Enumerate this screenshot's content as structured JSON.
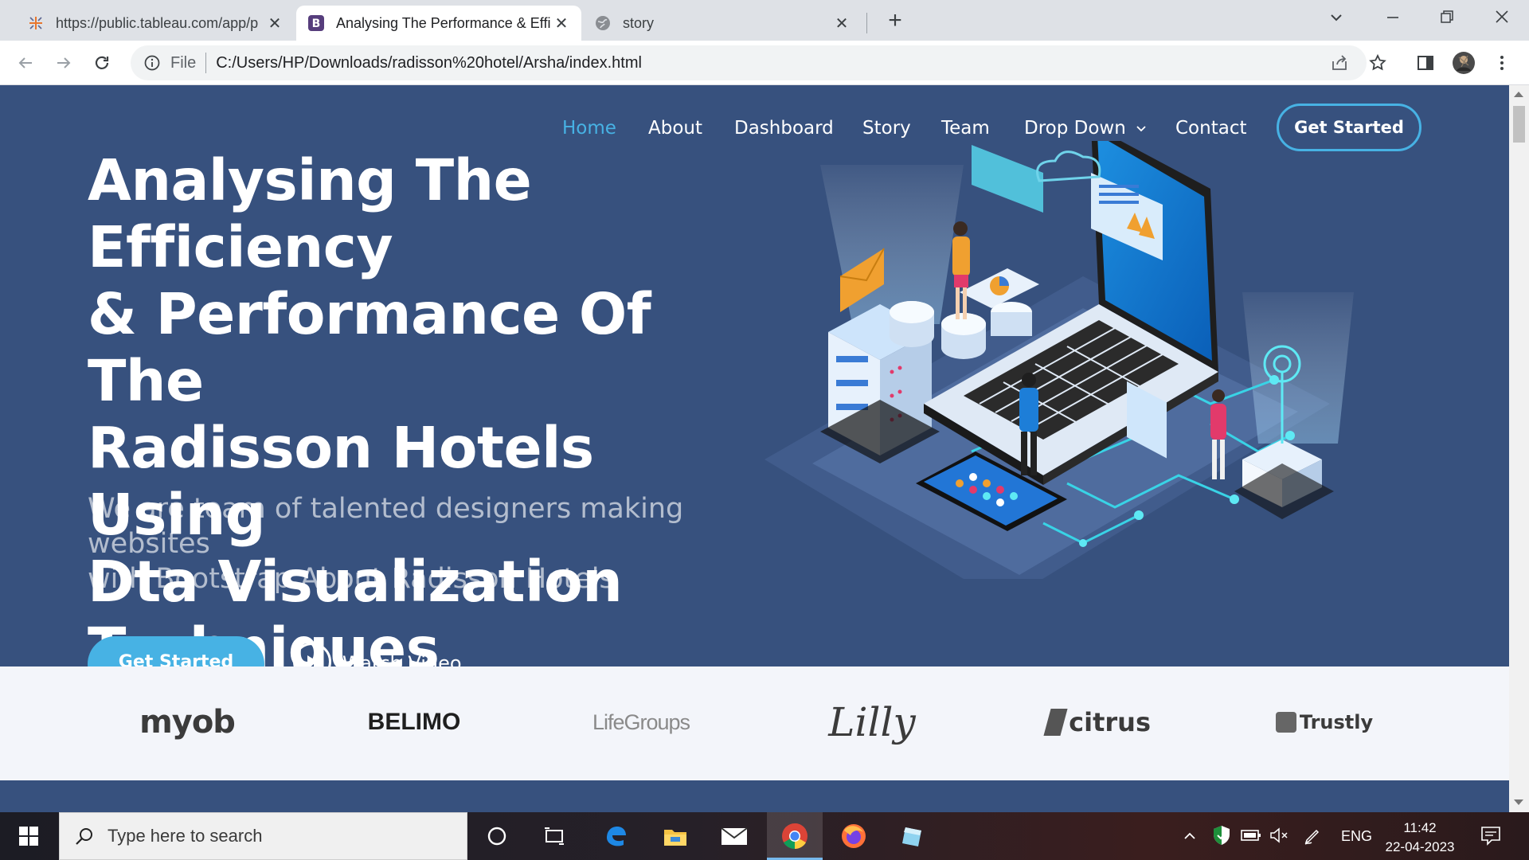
{
  "browser": {
    "tabs": [
      {
        "title": "https://public.tableau.com/app/p",
        "favicon": "tableau-icon",
        "active": false
      },
      {
        "title": "Analysing The Performance & Effi",
        "favicon": "bootstrap-icon",
        "active": true
      },
      {
        "title": "story",
        "favicon": "globe-icon",
        "active": false
      }
    ],
    "new_tab": "+",
    "omnibox": {
      "scheme": "File",
      "url": "C:/Users/HP/Downloads/radisson%20hotel/Arsha/index.html"
    }
  },
  "page": {
    "nav": {
      "items": [
        "Home",
        "About",
        "Dashboard",
        "Story",
        "Team",
        "Drop Down",
        "Contact"
      ],
      "active": "Home",
      "cta": "Get Started"
    },
    "hero": {
      "title_lines": [
        "Analysing The Efficiency",
        "& Performance Of The",
        "Radisson Hotels Using",
        "Dta Visualization",
        "Techniques"
      ],
      "subtitle_lines": [
        "We are team of talented designers making websites",
        "with Bootstrap About Radisson Hotels"
      ],
      "primary_button": "Get Started",
      "video_button": "Watch Video"
    },
    "clients": [
      "myob",
      "BELIMO",
      "LifeGroups",
      "Lilly",
      "citrus",
      "Trustly"
    ]
  },
  "taskbar": {
    "search_placeholder": "Type here to search",
    "language": "ENG",
    "time": "11:42",
    "date": "22-04-2023"
  },
  "colors": {
    "hero_bg": "#37517e",
    "accent": "#47b2e4",
    "clients_bg": "#f3f5fa"
  }
}
